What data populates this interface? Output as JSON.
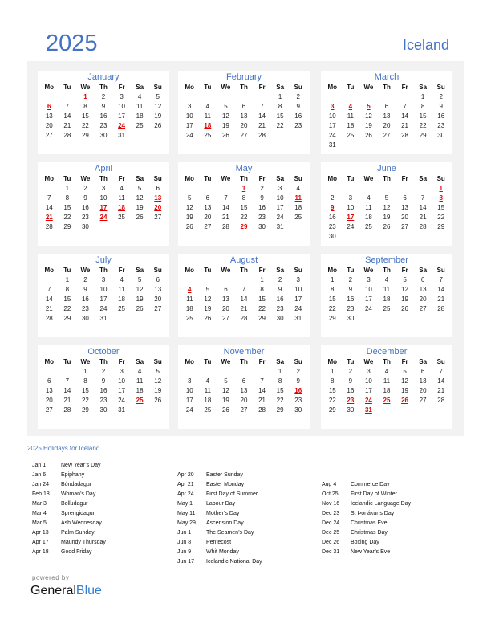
{
  "header": {
    "year": "2025",
    "country": "Iceland"
  },
  "weekday_labels": [
    "Mo",
    "Tu",
    "We",
    "Th",
    "Fr",
    "Sa",
    "Su"
  ],
  "months": [
    {
      "name": "January",
      "offset": 2,
      "days": 31,
      "holidays": [
        1,
        6,
        24
      ]
    },
    {
      "name": "February",
      "offset": 5,
      "days": 28,
      "holidays": [
        18
      ]
    },
    {
      "name": "March",
      "offset": 5,
      "days": 31,
      "holidays": [
        3,
        4,
        5
      ]
    },
    {
      "name": "April",
      "offset": 1,
      "days": 30,
      "holidays": [
        13,
        17,
        18,
        20,
        21,
        24
      ]
    },
    {
      "name": "May",
      "offset": 3,
      "days": 31,
      "holidays": [
        1,
        11,
        29
      ]
    },
    {
      "name": "June",
      "offset": 6,
      "days": 30,
      "holidays": [
        1,
        8,
        9,
        17
      ]
    },
    {
      "name": "July",
      "offset": 1,
      "days": 31,
      "holidays": []
    },
    {
      "name": "August",
      "offset": 4,
      "days": 31,
      "holidays": [
        4
      ]
    },
    {
      "name": "September",
      "offset": 0,
      "days": 30,
      "holidays": []
    },
    {
      "name": "October",
      "offset": 2,
      "days": 31,
      "holidays": [
        25
      ]
    },
    {
      "name": "November",
      "offset": 5,
      "days": 30,
      "holidays": [
        16
      ]
    },
    {
      "name": "December",
      "offset": 0,
      "days": 31,
      "holidays": [
        23,
        24,
        25,
        26,
        31
      ]
    }
  ],
  "holidays_title": "2025 Holidays for Iceland",
  "holiday_columns": [
    [
      {
        "date": "Jan 1",
        "name": "New Year’s Day"
      },
      {
        "date": "Jan 6",
        "name": "Epiphany"
      },
      {
        "date": "Jan 24",
        "name": "Bóndadagur"
      },
      {
        "date": "Feb 18",
        "name": "Woman’s Day"
      },
      {
        "date": "Mar 3",
        "name": "Bolludagur"
      },
      {
        "date": "Mar 4",
        "name": "Sprengidagur"
      },
      {
        "date": "Mar 5",
        "name": "Ash Wednesday"
      },
      {
        "date": "Apr 13",
        "name": "Palm Sunday"
      },
      {
        "date": "Apr 17",
        "name": "Maundy Thursday"
      },
      {
        "date": "Apr 18",
        "name": "Good Friday"
      }
    ],
    [
      {
        "date": "Apr 20",
        "name": "Easter Sunday"
      },
      {
        "date": "Apr 21",
        "name": "Easter Monday"
      },
      {
        "date": "Apr 24",
        "name": "First Day of Summer"
      },
      {
        "date": "May 1",
        "name": "Labour Day"
      },
      {
        "date": "May 11",
        "name": "Mother’s Day"
      },
      {
        "date": "May 29",
        "name": "Ascension Day"
      },
      {
        "date": "Jun 1",
        "name": "The Seamen’s Day"
      },
      {
        "date": "Jun 8",
        "name": "Pentecost"
      },
      {
        "date": "Jun 9",
        "name": "Whit Monday"
      },
      {
        "date": "Jun 17",
        "name": "Icelandic National Day"
      }
    ],
    [
      {
        "date": "Aug 4",
        "name": "Commerce Day"
      },
      {
        "date": "Oct 25",
        "name": "First Day of Winter"
      },
      {
        "date": "Nov 16",
        "name": "Icelandic Language Day"
      },
      {
        "date": "Dec 23",
        "name": "St Þorlákur’s Day"
      },
      {
        "date": "Dec 24",
        "name": "Christmas Eve"
      },
      {
        "date": "Dec 25",
        "name": "Christmas Day"
      },
      {
        "date": "Dec 26",
        "name": "Boxing Day"
      },
      {
        "date": "Dec 31",
        "name": "New Year’s Eve"
      }
    ]
  ],
  "footer": {
    "powered_by": "powered by",
    "brand_general": "General",
    "brand_blue": "Blue"
  },
  "colors": {
    "accent": "#4472c4",
    "holiday": "#e00000",
    "brand_blue": "#2e7fd0"
  }
}
